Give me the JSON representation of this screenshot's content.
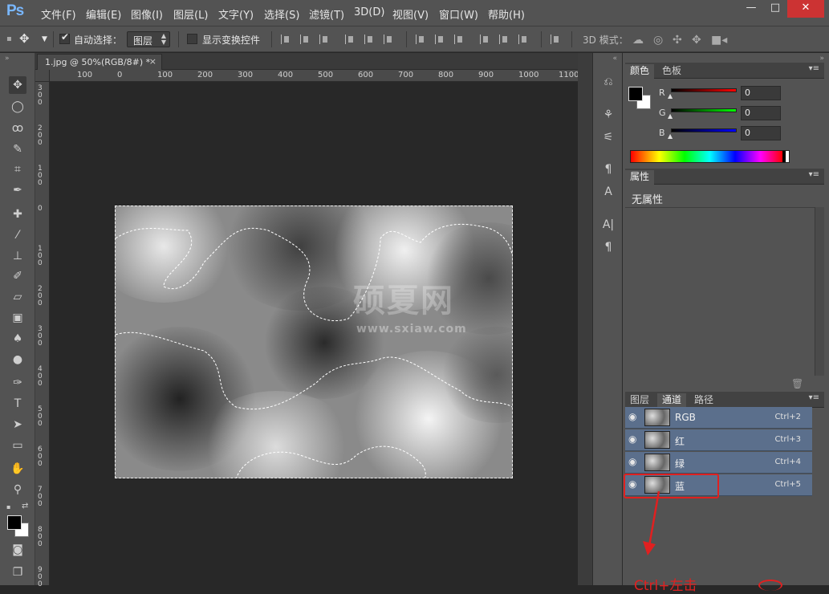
{
  "app": {
    "logo": "Ps"
  },
  "menu": [
    "文件(F)",
    "编辑(E)",
    "图像(I)",
    "图层(L)",
    "文字(Y)",
    "选择(S)",
    "滤镜(T)",
    "3D(D)",
    "视图(V)",
    "窗口(W)",
    "帮助(H)"
  ],
  "window_controls": {
    "minimize": "—",
    "restore": "□",
    "close": "✕"
  },
  "options": {
    "auto_select_label": "自动选择：",
    "auto_select_checked": true,
    "layer_select_value": "图层",
    "show_transform_label": "显示变换控件",
    "show_transform_checked": false,
    "mode_3d_label": "3D 模式："
  },
  "document": {
    "tab_label": "1.jpg @ 50%(RGB/8#) *",
    "tab_close": "×"
  },
  "ruler": {
    "top_labels": [
      "100",
      "0",
      "100",
      "200",
      "300",
      "400",
      "500",
      "600",
      "700",
      "800",
      "900",
      "1000",
      "1100"
    ],
    "left_labels": [
      "300",
      "200",
      "100",
      "0",
      "100",
      "200",
      "300",
      "400",
      "500",
      "600",
      "700",
      "800",
      "900"
    ]
  },
  "watermark": {
    "title": "硕夏网",
    "url": "www.sxiaw.com"
  },
  "color_panel": {
    "tabs": [
      "颜色",
      "色板"
    ],
    "active_tab": "颜色",
    "r_label": "R",
    "g_label": "G",
    "b_label": "B",
    "r_value": "0",
    "g_value": "0",
    "b_value": "0",
    "colors": {
      "r": "#ff0000",
      "g": "#00ff00",
      "b": "#0000ff",
      "foreground": "#000000",
      "background": "#ffffff"
    }
  },
  "properties_panel": {
    "tab": "属性",
    "empty_text": "无属性"
  },
  "channels_panel": {
    "tabs": [
      "图层",
      "通道",
      "路径"
    ],
    "active_tab": "通道",
    "rows": [
      {
        "name": "RGB",
        "shortcut": "Ctrl+2"
      },
      {
        "name": "红",
        "shortcut": "Ctrl+3"
      },
      {
        "name": "绿",
        "shortcut": "Ctrl+4"
      },
      {
        "name": "蓝",
        "shortcut": "Ctrl+5"
      }
    ]
  },
  "annotation": {
    "text": "Ctrl+左击"
  }
}
